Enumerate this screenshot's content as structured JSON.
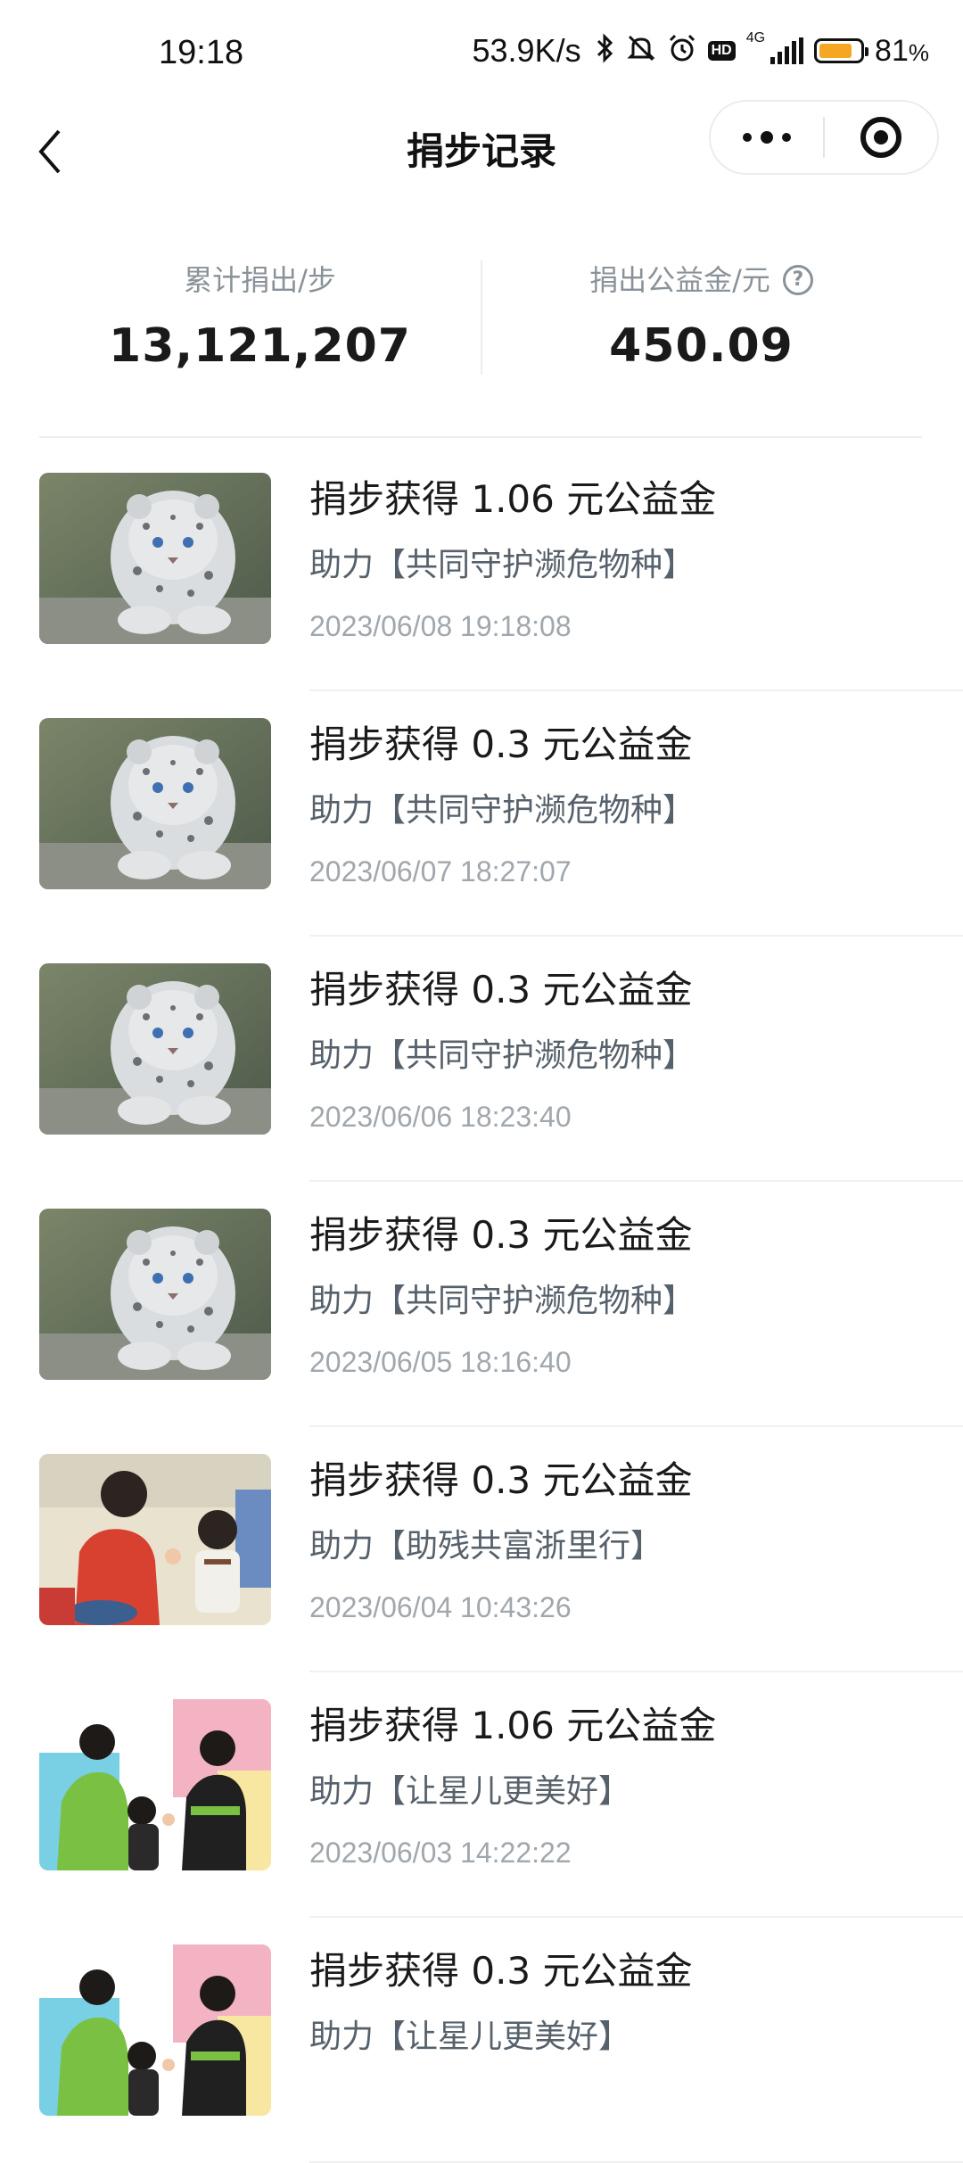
{
  "status_bar": {
    "time": "19:18",
    "net_speed": "53.9K/s",
    "network": "4G",
    "hd": "HD",
    "battery": "81",
    "battery_unit": "%",
    "battery_level": 0.81
  },
  "nav": {
    "title": "捐步记录"
  },
  "summary": {
    "steps_label": "累计捐出/步",
    "steps_value": "13,121,207",
    "fund_label": "捐出公益金/元",
    "fund_value": "450.09",
    "help_glyph": "?"
  },
  "records": [
    {
      "title": "捐步获得 1.06 元公益金",
      "project": "助力【共同守护濒危物种】",
      "time": "2023/06/08 19:18:08",
      "image": "snow-leopard"
    },
    {
      "title": "捐步获得 0.3 元公益金",
      "project": "助力【共同守护濒危物种】",
      "time": "2023/06/07 18:27:07",
      "image": "snow-leopard"
    },
    {
      "title": "捐步获得 0.3 元公益金",
      "project": "助力【共同守护濒危物种】",
      "time": "2023/06/06 18:23:40",
      "image": "snow-leopard"
    },
    {
      "title": "捐步获得 0.3 元公益金",
      "project": "助力【共同守护濒危物种】",
      "time": "2023/06/05 18:16:40",
      "image": "snow-leopard"
    },
    {
      "title": "捐步获得 0.3 元公益金",
      "project": "助力【助残共富浙里行】",
      "time": "2023/06/04 10:43:26",
      "image": "teacher-child"
    },
    {
      "title": "捐步获得 1.06 元公益金",
      "project": "助力【让星儿更美好】",
      "time": "2023/06/03 14:22:22",
      "image": "children-class"
    },
    {
      "title": "捐步获得 0.3 元公益金",
      "project": "助力【让星儿更美好】",
      "time": "",
      "image": "children-class"
    }
  ]
}
